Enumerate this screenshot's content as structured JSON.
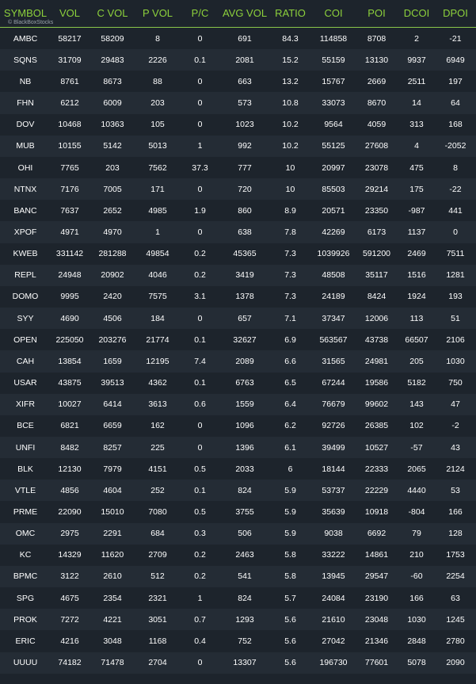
{
  "watermark": "© BlackBoxStocks",
  "columns": [
    "SYMBOL",
    "VOL",
    "C VOL",
    "P VOL",
    "P/C",
    "AVG VOL",
    "RATIO",
    "COI",
    "POI",
    "DCOI",
    "DPOI"
  ],
  "rows": [
    [
      "AMBC",
      "58217",
      "58209",
      "8",
      "0",
      "691",
      "84.3",
      "114858",
      "8708",
      "2",
      "-21"
    ],
    [
      "SQNS",
      "31709",
      "29483",
      "2226",
      "0.1",
      "2081",
      "15.2",
      "55159",
      "13130",
      "9937",
      "6949"
    ],
    [
      "NB",
      "8761",
      "8673",
      "88",
      "0",
      "663",
      "13.2",
      "15767",
      "2669",
      "2511",
      "197"
    ],
    [
      "FHN",
      "6212",
      "6009",
      "203",
      "0",
      "573",
      "10.8",
      "33073",
      "8670",
      "14",
      "64"
    ],
    [
      "DOV",
      "10468",
      "10363",
      "105",
      "0",
      "1023",
      "10.2",
      "9564",
      "4059",
      "313",
      "168"
    ],
    [
      "MUB",
      "10155",
      "5142",
      "5013",
      "1",
      "992",
      "10.2",
      "55125",
      "27608",
      "4",
      "-2052"
    ],
    [
      "OHI",
      "7765",
      "203",
      "7562",
      "37.3",
      "777",
      "10",
      "20997",
      "23078",
      "475",
      "8"
    ],
    [
      "NTNX",
      "7176",
      "7005",
      "171",
      "0",
      "720",
      "10",
      "85503",
      "29214",
      "175",
      "-22"
    ],
    [
      "BANC",
      "7637",
      "2652",
      "4985",
      "1.9",
      "860",
      "8.9",
      "20571",
      "23350",
      "-987",
      "441"
    ],
    [
      "XPOF",
      "4971",
      "4970",
      "1",
      "0",
      "638",
      "7.8",
      "42269",
      "6173",
      "1137",
      "0"
    ],
    [
      "KWEB",
      "331142",
      "281288",
      "49854",
      "0.2",
      "45365",
      "7.3",
      "1039926",
      "591200",
      "2469",
      "7511"
    ],
    [
      "REPL",
      "24948",
      "20902",
      "4046",
      "0.2",
      "3419",
      "7.3",
      "48508",
      "35117",
      "1516",
      "1281"
    ],
    [
      "DOMO",
      "9995",
      "2420",
      "7575",
      "3.1",
      "1378",
      "7.3",
      "24189",
      "8424",
      "1924",
      "193"
    ],
    [
      "SYY",
      "4690",
      "4506",
      "184",
      "0",
      "657",
      "7.1",
      "37347",
      "12006",
      "113",
      "51"
    ],
    [
      "OPEN",
      "225050",
      "203276",
      "21774",
      "0.1",
      "32627",
      "6.9",
      "563567",
      "43738",
      "66507",
      "2106"
    ],
    [
      "CAH",
      "13854",
      "1659",
      "12195",
      "7.4",
      "2089",
      "6.6",
      "31565",
      "24981",
      "205",
      "1030"
    ],
    [
      "USAR",
      "43875",
      "39513",
      "4362",
      "0.1",
      "6763",
      "6.5",
      "67244",
      "19586",
      "5182",
      "750"
    ],
    [
      "XIFR",
      "10027",
      "6414",
      "3613",
      "0.6",
      "1559",
      "6.4",
      "76679",
      "99602",
      "143",
      "47"
    ],
    [
      "BCE",
      "6821",
      "6659",
      "162",
      "0",
      "1096",
      "6.2",
      "92726",
      "26385",
      "102",
      "-2"
    ],
    [
      "UNFI",
      "8482",
      "8257",
      "225",
      "0",
      "1396",
      "6.1",
      "39499",
      "10527",
      "-57",
      "43"
    ],
    [
      "BLK",
      "12130",
      "7979",
      "4151",
      "0.5",
      "2033",
      "6",
      "18144",
      "22333",
      "2065",
      "2124"
    ],
    [
      "VTLE",
      "4856",
      "4604",
      "252",
      "0.1",
      "824",
      "5.9",
      "53737",
      "22229",
      "4440",
      "53"
    ],
    [
      "PRME",
      "22090",
      "15010",
      "7080",
      "0.5",
      "3755",
      "5.9",
      "35639",
      "10918",
      "-804",
      "166"
    ],
    [
      "OMC",
      "2975",
      "2291",
      "684",
      "0.3",
      "506",
      "5.9",
      "9038",
      "6692",
      "79",
      "128"
    ],
    [
      "KC",
      "14329",
      "11620",
      "2709",
      "0.2",
      "2463",
      "5.8",
      "33222",
      "14861",
      "210",
      "1753"
    ],
    [
      "BPMC",
      "3122",
      "2610",
      "512",
      "0.2",
      "541",
      "5.8",
      "13945",
      "29547",
      "-60",
      "2254"
    ],
    [
      "SPG",
      "4675",
      "2354",
      "2321",
      "1",
      "824",
      "5.7",
      "24084",
      "23190",
      "166",
      "63"
    ],
    [
      "PROK",
      "7272",
      "4221",
      "3051",
      "0.7",
      "1293",
      "5.6",
      "21610",
      "23048",
      "1030",
      "1245"
    ],
    [
      "ERIC",
      "4216",
      "3048",
      "1168",
      "0.4",
      "752",
      "5.6",
      "27042",
      "21346",
      "2848",
      "2780"
    ],
    [
      "UUUU",
      "74182",
      "71478",
      "2704",
      "0",
      "13307",
      "5.6",
      "196730",
      "77601",
      "5078",
      "2090"
    ]
  ],
  "colors": {
    "header_text": "#8dd13c",
    "header_rule": "#8ac64a",
    "row_dark": "#1d242c",
    "row_light": "#242c35",
    "cell_text": "#ffffff"
  }
}
